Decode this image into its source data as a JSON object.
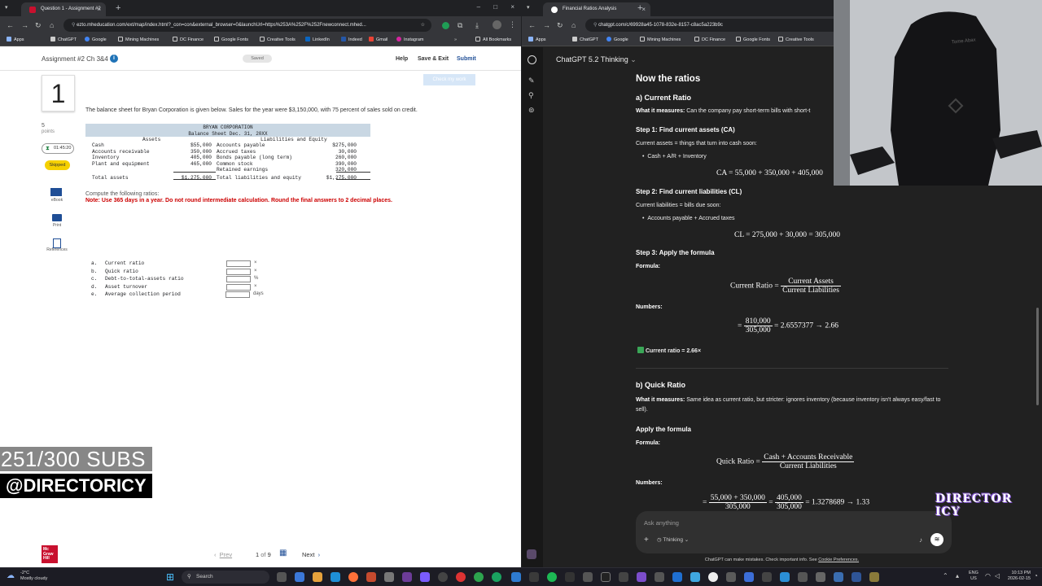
{
  "left_browser": {
    "tab_title": "Question 1 - Assignment #2 Ch",
    "url": "ezto.mheducation.com/ext/map/index.html?_con=con&external_browser=0&launchUrl=https%253A%252F%252Fnewconnect.mhed...",
    "bookmarks": [
      "Apps",
      "ChatGPT",
      "Google",
      "Mining Machines",
      "DC Finance",
      "Google Fonts",
      "Creative Tools",
      "LinkedIn",
      "Indeed",
      "Gmail",
      "Instagram",
      "All Bookmarks"
    ]
  },
  "assignment": {
    "title": "Assignment #2 Ch 3&4",
    "saved": "Saved",
    "help": "Help",
    "save_exit": "Save & Exit",
    "submit": "Submit",
    "check_work": "Check my work",
    "question_number": "1",
    "points_value": "5",
    "points_label": "points",
    "timer": "01:45:20",
    "skipped": "Skipped",
    "side_tools": [
      "eBook",
      "Print",
      "References"
    ],
    "prompt": "The balance sheet for Bryan Corporation is given below. Sales for the year were $3,150,000, with 75 percent of sales sold on credit.",
    "bs_company": "BRYAN CORPORATION",
    "bs_date": "Balance Sheet Dec. 31, 20XX",
    "bs_assets_header": "Assets",
    "bs_liab_header": "Liabilities and Equity",
    "bs_rows": [
      {
        "a": "Cash",
        "av": "$55,000",
        "l": "Accounts payable",
        "lv": "$275,000"
      },
      {
        "a": "Accounts receivable",
        "av": "350,000",
        "l": "Accrued taxes",
        "lv": "30,000"
      },
      {
        "a": "Inventory",
        "av": "405,000",
        "l": "Bonds payable (long term)",
        "lv": "260,000"
      },
      {
        "a": "Plant and equipment",
        "av": "465,000",
        "l": "Common stock",
        "lv": "390,000"
      },
      {
        "a": "",
        "av": "",
        "l": "Retained earnings",
        "lv": "320,000"
      },
      {
        "a": "Total assets",
        "av": "$1,275,000",
        "l": "Total liabilities and equity",
        "lv": "$1,275,000"
      }
    ],
    "compute": "Compute the following ratios:",
    "note": "Note: Use 365 days in a year. Do not round intermediate calculation. Round the final answers to 2 decimal places.",
    "ratios": [
      {
        "letter": "a.",
        "name": "Current ratio",
        "unit": "×"
      },
      {
        "letter": "b.",
        "name": "Quick ratio",
        "unit": "×"
      },
      {
        "letter": "c.",
        "name": "Debt-to-total-assets ratio",
        "unit": "%"
      },
      {
        "letter": "d.",
        "name": "Asset turnover",
        "unit": "×"
      },
      {
        "letter": "e.",
        "name": "Average collection period",
        "unit": "days"
      }
    ],
    "prev": "Prev",
    "page_current": "1",
    "page_of": "of",
    "page_total": "9",
    "next": "Next",
    "publisher_logo": "Mc Graw Hill"
  },
  "overlay": {
    "subs": "251/300 SUBS",
    "handle": "@DIRECTORICY",
    "brand": "DIRECTOR ICY",
    "chair_text": "Tome Abax"
  },
  "right_browser": {
    "tab_title": "Financial Ratios Analysis",
    "url": "chatgpt.com/c/69928a45-1078-832e-8157-c8ac5a223b9c",
    "bookmarks": [
      "Apps",
      "ChatGPT",
      "Google",
      "Mining Machines",
      "DC Finance",
      "Google Fonts",
      "Creative Tools"
    ]
  },
  "chatgpt": {
    "model": "ChatGPT 5.2 Thinking",
    "h1": "Now the ratios",
    "a_title": "a) Current Ratio",
    "a_measures_label": "What it measures:",
    "a_measures": "Can the company pay short-term bills with short-t",
    "step1": "Step 1: Find current assets (CA)",
    "step1_text": "Current assets = things that turn into cash soon:",
    "step1_bullet": "Cash + A/R + Inventory",
    "ca_eq": "CA = 55,000 + 350,000 + 405,000",
    "step2": "Step 2: Find current liabilities (CL)",
    "step2_text": "Current liabilities = bills due soon:",
    "step2_bullet": "Accounts payable + Accrued taxes",
    "cl_eq": "CL = 275,000 + 30,000 = 305,000",
    "step3": "Step 3: Apply the formula",
    "formula_label": "Formula:",
    "cr_lhs": "Current Ratio =",
    "cr_num": "Current Assets",
    "cr_den": "Current Liabilities",
    "numbers_label": "Numbers:",
    "cr_n_num": "810,000",
    "cr_n_den": "305,000",
    "cr_n_rest": "= 2.6557377 → 2.66",
    "cr_result": "Current ratio = 2.66×",
    "b_title": "b) Quick Ratio",
    "b_measures_label": "What it measures:",
    "b_measures": "Same idea as current ratio, but stricter: ignores inventory (because inventory isn't always easy/fast to sell).",
    "apply": "Apply the formula",
    "formula_label2": "Formula:",
    "qr_lhs": "Quick Ratio =",
    "qr_num": "Cash + Accounts Receivable",
    "qr_den": "Current Liabilities",
    "numbers_label2": "Numbers:",
    "qr_n1_num": "55,000 + 350,000",
    "qr_n1_den": "305,000",
    "qr_n2_num": "405,000",
    "qr_n2_den": "305,000",
    "qr_rest": "= 1.3278689 → 1.33",
    "input_placeholder": "Ask anything",
    "thinking": "Thinking",
    "disclaimer": "ChatGPT can make mistakes. Check important info. See",
    "cookie": "Cookie Preferences."
  },
  "taskbar": {
    "temp": "-2°C",
    "weather": "Mostly cloudy",
    "search": "Search",
    "lang1": "ENG",
    "lang2": "US",
    "time": "10:13 PM",
    "date": "2026-02-15"
  }
}
